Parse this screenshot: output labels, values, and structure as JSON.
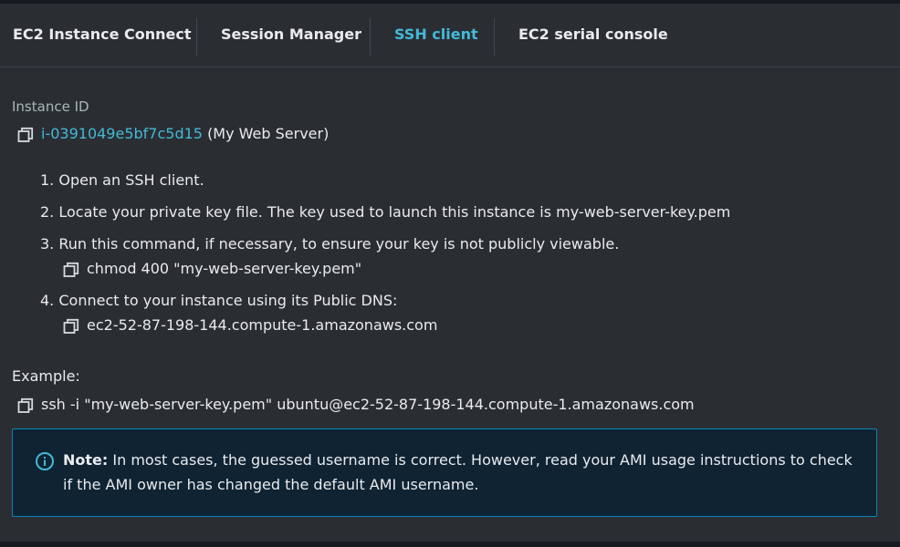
{
  "tabs": [
    {
      "label": "EC2 Instance Connect",
      "active": false
    },
    {
      "label": "Session Manager",
      "active": false
    },
    {
      "label": "SSH client",
      "active": true
    },
    {
      "label": "EC2 serial console",
      "active": false
    }
  ],
  "instance": {
    "label": "Instance ID",
    "id": "i-0391049e5bf7c5d15",
    "name": "(My Web Server)"
  },
  "steps": [
    {
      "text": "1. Open an SSH client."
    },
    {
      "text": "2. Locate your private key file. The key used to launch this instance is my-web-server-key.pem"
    },
    {
      "text": "3. Run this command, if necessary, to ensure your key is not publicly viewable.",
      "command": "chmod 400 \"my-web-server-key.pem\""
    },
    {
      "text": "4. Connect to your instance using its Public DNS:",
      "command": "ec2-52-87-198-144.compute-1.amazonaws.com"
    }
  ],
  "example": {
    "label": "Example:",
    "command": "ssh -i \"my-web-server-key.pem\" ubuntu@ec2-52-87-198-144.compute-1.amazonaws.com"
  },
  "note": {
    "title": "Note:",
    "body": " In most cases, the guessed username is correct. However, read your AMI usage instructions to check if the AMI owner has changed the default AMI username."
  },
  "colors": {
    "background": "#2a2e33",
    "accent": "#44b9d6",
    "note_background": "#0f2333",
    "note_border": "#0a84b6",
    "text": "#e9ebed"
  },
  "icons": {
    "copy": "copy-icon",
    "info": "info-icon"
  }
}
